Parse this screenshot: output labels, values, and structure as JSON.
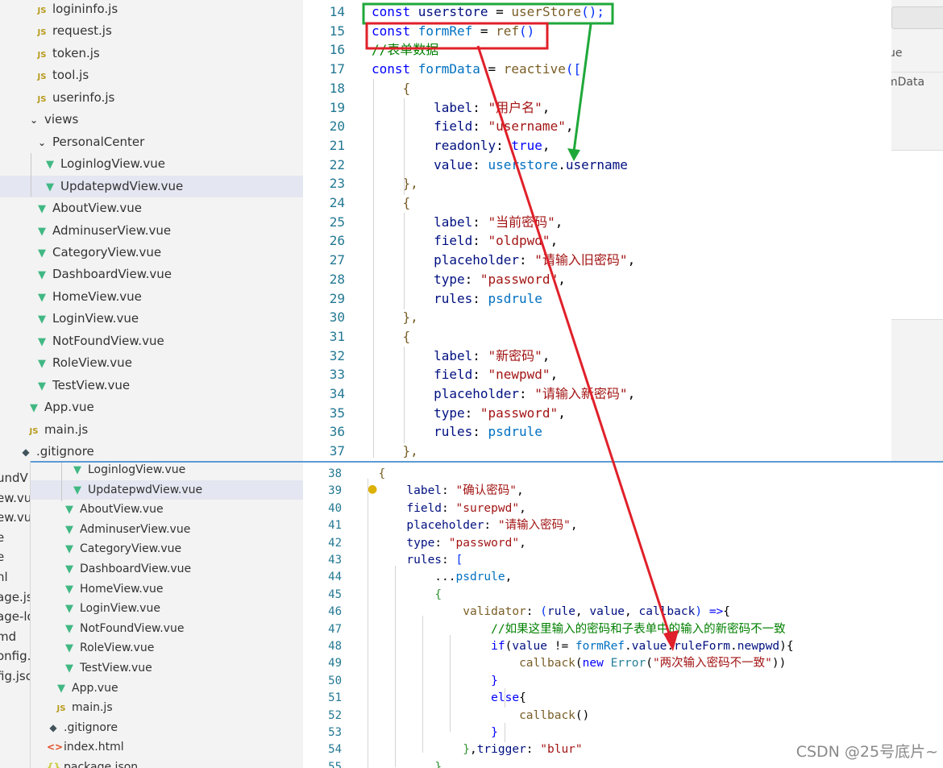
{
  "top_explorer": {
    "items": [
      {
        "label": "logininfo.js",
        "icon": "js-file-icon",
        "indent": 1
      },
      {
        "label": "request.js",
        "icon": "js-file-icon",
        "indent": 1
      },
      {
        "label": "token.js",
        "icon": "js-file-icon",
        "indent": 1
      },
      {
        "label": "tool.js",
        "icon": "js-file-icon",
        "indent": 1
      },
      {
        "label": "userinfo.js",
        "icon": "js-file-icon",
        "indent": 1
      },
      {
        "label": "views",
        "icon": "chevron-down-icon",
        "indent": 0
      },
      {
        "label": "PersonalCenter",
        "icon": "chevron-down-icon",
        "indent": 1
      },
      {
        "label": "LoginlogView.vue",
        "icon": "vue-file-icon",
        "indent": 2
      },
      {
        "label": "UpdatepwdView.vue",
        "icon": "vue-file-icon",
        "indent": 2,
        "selected": true
      },
      {
        "label": "AboutView.vue",
        "icon": "vue-file-icon",
        "indent": 1
      },
      {
        "label": "AdminuserView.vue",
        "icon": "vue-file-icon",
        "indent": 1
      },
      {
        "label": "CategoryView.vue",
        "icon": "vue-file-icon",
        "indent": 1
      },
      {
        "label": "DashboardView.vue",
        "icon": "vue-file-icon",
        "indent": 1
      },
      {
        "label": "HomeView.vue",
        "icon": "vue-file-icon",
        "indent": 1
      },
      {
        "label": "LoginView.vue",
        "icon": "vue-file-icon",
        "indent": 1
      },
      {
        "label": "NotFoundView.vue",
        "icon": "vue-file-icon",
        "indent": 1
      },
      {
        "label": "RoleView.vue",
        "icon": "vue-file-icon",
        "indent": 1
      },
      {
        "label": "TestView.vue",
        "icon": "vue-file-icon",
        "indent": 1
      },
      {
        "label": "App.vue",
        "icon": "vue-file-icon",
        "indent": 0
      },
      {
        "label": "main.js",
        "icon": "js-file-icon",
        "indent": 0
      },
      {
        "label": ".gitignore",
        "icon": "git-file-icon",
        "indent": -1
      }
    ]
  },
  "top_editor": {
    "lines": [
      {
        "n": "14",
        "tokens": [
          [
            "kw",
            "const "
          ],
          [
            "vr",
            "userstore"
          ],
          [
            "pl",
            " = "
          ],
          [
            "fn",
            "userStore"
          ],
          [
            "br",
            "();"
          ]
        ]
      },
      {
        "n": "15",
        "tokens": [
          [
            "kw",
            "const "
          ],
          [
            "cn",
            "formRef"
          ],
          [
            "pl",
            " = "
          ],
          [
            "fn",
            "ref"
          ],
          [
            "br",
            "()"
          ]
        ]
      },
      {
        "n": "16",
        "tokens": [
          [
            "cm",
            "//表单数据"
          ]
        ]
      },
      {
        "n": "17",
        "tokens": [
          [
            "kw",
            "const "
          ],
          [
            "cn",
            "formData"
          ],
          [
            "pl",
            " = "
          ],
          [
            "fn",
            "reactive"
          ],
          [
            "br",
            "(["
          ]
        ]
      },
      {
        "n": "18",
        "tokens": [
          [
            "pl",
            "    "
          ],
          [
            "fn",
            "{"
          ]
        ]
      },
      {
        "n": "19",
        "tokens": [
          [
            "pl",
            "        "
          ],
          [
            "vr",
            "label"
          ],
          [
            "pl",
            ": "
          ],
          [
            "st",
            "\"用户名\""
          ],
          [
            "pl",
            ","
          ]
        ]
      },
      {
        "n": "20",
        "tokens": [
          [
            "pl",
            "        "
          ],
          [
            "vr",
            "field"
          ],
          [
            "pl",
            ": "
          ],
          [
            "st",
            "\"username\""
          ],
          [
            "pl",
            ","
          ]
        ]
      },
      {
        "n": "21",
        "tokens": [
          [
            "pl",
            "        "
          ],
          [
            "vr",
            "readonly"
          ],
          [
            "pl",
            ": "
          ],
          [
            "bl",
            "true"
          ],
          [
            "pl",
            ","
          ]
        ]
      },
      {
        "n": "22",
        "tokens": [
          [
            "pl",
            "        "
          ],
          [
            "vr",
            "value"
          ],
          [
            "pl",
            ": "
          ],
          [
            "cn",
            "userstore"
          ],
          [
            "pl",
            "."
          ],
          [
            "vr",
            "username"
          ]
        ]
      },
      {
        "n": "23",
        "tokens": [
          [
            "pl",
            "    "
          ],
          [
            "fn",
            "},"
          ]
        ]
      },
      {
        "n": "24",
        "tokens": [
          [
            "pl",
            "    "
          ],
          [
            "fn",
            "{"
          ]
        ]
      },
      {
        "n": "25",
        "tokens": [
          [
            "pl",
            "        "
          ],
          [
            "vr",
            "label"
          ],
          [
            "pl",
            ": "
          ],
          [
            "st",
            "\"当前密码\""
          ],
          [
            "pl",
            ","
          ]
        ]
      },
      {
        "n": "26",
        "tokens": [
          [
            "pl",
            "        "
          ],
          [
            "vr",
            "field"
          ],
          [
            "pl",
            ": "
          ],
          [
            "st",
            "\"oldpwd\""
          ],
          [
            "pl",
            ","
          ]
        ]
      },
      {
        "n": "27",
        "tokens": [
          [
            "pl",
            "        "
          ],
          [
            "vr",
            "placeholder"
          ],
          [
            "pl",
            ": "
          ],
          [
            "st",
            "\"请输入旧密码\""
          ],
          [
            "pl",
            ","
          ]
        ]
      },
      {
        "n": "28",
        "tokens": [
          [
            "pl",
            "        "
          ],
          [
            "vr",
            "type"
          ],
          [
            "pl",
            ": "
          ],
          [
            "st",
            "\"password\""
          ],
          [
            "pl",
            ","
          ]
        ]
      },
      {
        "n": "29",
        "tokens": [
          [
            "pl",
            "        "
          ],
          [
            "vr",
            "rules"
          ],
          [
            "pl",
            ": "
          ],
          [
            "cn",
            "psdrule"
          ]
        ]
      },
      {
        "n": "30",
        "tokens": [
          [
            "pl",
            "    "
          ],
          [
            "fn",
            "},"
          ]
        ]
      },
      {
        "n": "31",
        "tokens": [
          [
            "pl",
            "    "
          ],
          [
            "fn",
            "{"
          ]
        ]
      },
      {
        "n": "32",
        "tokens": [
          [
            "pl",
            "        "
          ],
          [
            "vr",
            "label"
          ],
          [
            "pl",
            ": "
          ],
          [
            "st",
            "\"新密码\""
          ],
          [
            "pl",
            ","
          ]
        ]
      },
      {
        "n": "33",
        "tokens": [
          [
            "pl",
            "        "
          ],
          [
            "vr",
            "field"
          ],
          [
            "pl",
            ": "
          ],
          [
            "st",
            "\"newpwd\""
          ],
          [
            "pl",
            ","
          ]
        ]
      },
      {
        "n": "34",
        "tokens": [
          [
            "pl",
            "        "
          ],
          [
            "vr",
            "placeholder"
          ],
          [
            "pl",
            ": "
          ],
          [
            "st",
            "\"请输入新密码\""
          ],
          [
            "pl",
            ","
          ]
        ]
      },
      {
        "n": "35",
        "tokens": [
          [
            "pl",
            "        "
          ],
          [
            "vr",
            "type"
          ],
          [
            "pl",
            ": "
          ],
          [
            "st",
            "\"password\""
          ],
          [
            "pl",
            ","
          ]
        ]
      },
      {
        "n": "36",
        "tokens": [
          [
            "pl",
            "        "
          ],
          [
            "vr",
            "rules"
          ],
          [
            "pl",
            ": "
          ],
          [
            "cn",
            "psdrule"
          ]
        ]
      },
      {
        "n": "37",
        "tokens": [
          [
            "pl",
            "    "
          ],
          [
            "fn",
            "},"
          ]
        ]
      }
    ]
  },
  "top_right": {
    "text_ue": "ue",
    "text_mdata": "mData"
  },
  "bottom_strip": {
    "fragments": [
      "undV",
      "ew.vu",
      "ew.vu",
      "e",
      "e",
      "nl",
      "age.jsc",
      "age-lo",
      "md",
      "onfig.",
      "fig.jsc"
    ]
  },
  "bottom_explorer": {
    "items": [
      {
        "label": "LoginlogView.vue",
        "icon": "vue-file-icon",
        "indent": 2
      },
      {
        "label": "UpdatepwdView.vue",
        "icon": "vue-file-icon",
        "indent": 2,
        "selected": true
      },
      {
        "label": "AboutView.vue",
        "icon": "vue-file-icon",
        "indent": 1
      },
      {
        "label": "AdminuserView.vue",
        "icon": "vue-file-icon",
        "indent": 1
      },
      {
        "label": "CategoryView.vue",
        "icon": "vue-file-icon",
        "indent": 1
      },
      {
        "label": "DashboardView.vue",
        "icon": "vue-file-icon",
        "indent": 1
      },
      {
        "label": "HomeView.vue",
        "icon": "vue-file-icon",
        "indent": 1
      },
      {
        "label": "LoginView.vue",
        "icon": "vue-file-icon",
        "indent": 1
      },
      {
        "label": "NotFoundView.vue",
        "icon": "vue-file-icon",
        "indent": 1
      },
      {
        "label": "RoleView.vue",
        "icon": "vue-file-icon",
        "indent": 1
      },
      {
        "label": "TestView.vue",
        "icon": "vue-file-icon",
        "indent": 1
      },
      {
        "label": "App.vue",
        "icon": "vue-file-icon",
        "indent": 0
      },
      {
        "label": "main.js",
        "icon": "js-file-icon",
        "indent": 0
      },
      {
        "label": ".gitignore",
        "icon": "git-file-icon",
        "indent": -1
      },
      {
        "label": "index.html",
        "icon": "html-file-icon",
        "indent": -1
      },
      {
        "label": "package.json",
        "icon": "json-file-icon",
        "indent": -1
      }
    ]
  },
  "bottom_editor": {
    "lines": [
      {
        "n": "38",
        "tokens": [
          [
            "pl",
            "  "
          ],
          [
            "fn",
            "{"
          ]
        ]
      },
      {
        "n": "39",
        "tokens": [
          [
            "pl",
            "      "
          ],
          [
            "vr",
            "label"
          ],
          [
            "pl",
            ": "
          ],
          [
            "st",
            "\"确认密码\""
          ],
          [
            "pl",
            ","
          ]
        ]
      },
      {
        "n": "40",
        "tokens": [
          [
            "pl",
            "      "
          ],
          [
            "vr",
            "field"
          ],
          [
            "pl",
            ": "
          ],
          [
            "st",
            "\"surepwd\""
          ],
          [
            "pl",
            ","
          ]
        ]
      },
      {
        "n": "41",
        "tokens": [
          [
            "pl",
            "      "
          ],
          [
            "vr",
            "placeholder"
          ],
          [
            "pl",
            ": "
          ],
          [
            "st",
            "\"请输入密码\""
          ],
          [
            "pl",
            ","
          ]
        ]
      },
      {
        "n": "42",
        "tokens": [
          [
            "pl",
            "      "
          ],
          [
            "vr",
            "type"
          ],
          [
            "pl",
            ": "
          ],
          [
            "st",
            "\"password\""
          ],
          [
            "pl",
            ","
          ]
        ]
      },
      {
        "n": "43",
        "tokens": [
          [
            "pl",
            "      "
          ],
          [
            "vr",
            "rules"
          ],
          [
            "pl",
            ": "
          ],
          [
            "br",
            "["
          ]
        ]
      },
      {
        "n": "44",
        "tokens": [
          [
            "pl",
            "          ..."
          ],
          [
            "cn",
            "psdrule"
          ],
          [
            "pl",
            ","
          ]
        ]
      },
      {
        "n": "45",
        "tokens": [
          [
            "pl",
            "          "
          ],
          [
            "pr",
            "{"
          ]
        ]
      },
      {
        "n": "46",
        "tokens": [
          [
            "pl",
            "              "
          ],
          [
            "fn",
            "validator"
          ],
          [
            "pl",
            ": "
          ],
          [
            "br",
            "("
          ],
          [
            "vr",
            "rule"
          ],
          [
            "pl",
            ", "
          ],
          [
            "vr",
            "value"
          ],
          [
            "pl",
            ", "
          ],
          [
            "vr",
            "callback"
          ],
          [
            "br",
            ")"
          ],
          [
            "pl",
            " "
          ],
          [
            "bl",
            "=>"
          ],
          [
            "pl",
            "{"
          ]
        ]
      },
      {
        "n": "47",
        "tokens": [
          [
            "pl",
            "                  "
          ],
          [
            "cm",
            "//如果这里输入的密码和子表单中的输入的新密码不一致"
          ]
        ]
      },
      {
        "n": "48",
        "tokens": [
          [
            "pl",
            "                  "
          ],
          [
            "bl",
            "if"
          ],
          [
            "pl",
            "("
          ],
          [
            "vr",
            "value"
          ],
          [
            "pl",
            " != "
          ],
          [
            "cn",
            "formRef"
          ],
          [
            "pl",
            "."
          ],
          [
            "vr",
            "value"
          ],
          [
            "pl",
            "."
          ],
          [
            "vr",
            "ruleForm"
          ],
          [
            "pl",
            "."
          ],
          [
            "vr",
            "newpwd"
          ],
          [
            "pl",
            "){"
          ]
        ]
      },
      {
        "n": "49",
        "tokens": [
          [
            "pl",
            "                      "
          ],
          [
            "fn",
            "callback"
          ],
          [
            "pl",
            "("
          ],
          [
            "bl",
            "new "
          ],
          [
            "ty",
            "Error"
          ],
          [
            "pl",
            "("
          ],
          [
            "st",
            "\"两次输入密码不一致\""
          ],
          [
            "pl",
            "))"
          ]
        ]
      },
      {
        "n": "50",
        "tokens": [
          [
            "pl",
            "                  "
          ],
          [
            "bl",
            "}"
          ]
        ]
      },
      {
        "n": "51",
        "tokens": [
          [
            "pl",
            "                  "
          ],
          [
            "bl",
            "else"
          ],
          [
            "pl",
            "{"
          ]
        ]
      },
      {
        "n": "52",
        "tokens": [
          [
            "pl",
            "                      "
          ],
          [
            "fn",
            "callback"
          ],
          [
            "pl",
            "()"
          ]
        ]
      },
      {
        "n": "53",
        "tokens": [
          [
            "pl",
            "                  "
          ],
          [
            "bl",
            "}"
          ]
        ]
      },
      {
        "n": "54",
        "tokens": [
          [
            "pl",
            "              "
          ],
          [
            "pr",
            "}"
          ],
          [
            "pl",
            ","
          ],
          [
            "vr",
            "trigger"
          ],
          [
            "pl",
            ": "
          ],
          [
            "st",
            "\"blur\""
          ]
        ]
      },
      {
        "n": "55",
        "tokens": [
          [
            "pl",
            "          "
          ],
          [
            "pr",
            "}"
          ]
        ]
      }
    ]
  },
  "overlay_line_text": "rules",
  "watermark": "CSDN @25号底片~",
  "colors": {
    "green_box": "#1fa83a",
    "red_box": "#e0202a"
  }
}
